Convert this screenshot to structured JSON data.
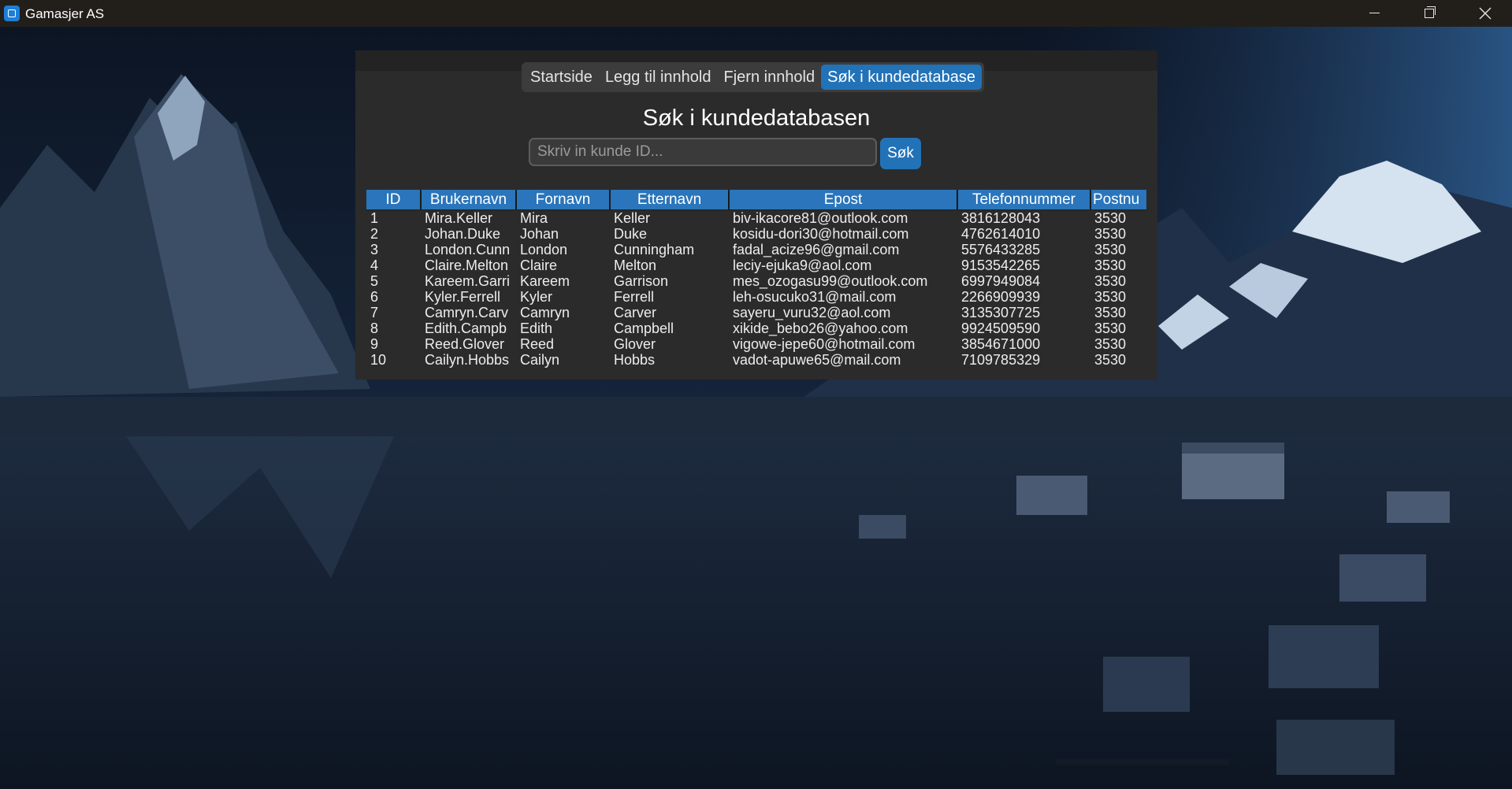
{
  "window": {
    "title": "Gamasjer AS"
  },
  "icons": {
    "app": "app-icon",
    "minimize": "minimize-icon",
    "maximize": "maximize-icon",
    "close": "close-icon"
  },
  "colors": {
    "accent": "#2272b8",
    "panel_bg": "#2b2b2b",
    "titlebar_bg": "#221f1b"
  },
  "nav": {
    "tabs": [
      {
        "label": "Startside",
        "active": false
      },
      {
        "label": "Legg til innhold",
        "active": false
      },
      {
        "label": "Fjern innhold",
        "active": false
      },
      {
        "label": "Søk i kundedatabase",
        "active": true
      }
    ]
  },
  "page": {
    "title": "Søk i kundedatabasen"
  },
  "search": {
    "placeholder": "Skriv in kunde ID...",
    "value": "",
    "button_label": "Søk"
  },
  "table": {
    "columns": [
      "ID",
      "Brukernavn",
      "Fornavn",
      "Etternavn",
      "Epost",
      "Telefonnummer",
      "Postnu"
    ],
    "rows": [
      [
        "1",
        "Mira.Keller",
        "Mira",
        "Keller",
        "biv-ikacore81@outlook.com",
        "3816128043",
        "3530"
      ],
      [
        "2",
        "Johan.Duke",
        "Johan",
        "Duke",
        "kosidu-dori30@hotmail.com",
        "4762614010",
        "3530"
      ],
      [
        "3",
        "London.Cunn",
        "London",
        "Cunningham",
        "fadal_acize96@gmail.com",
        "5576433285",
        "3530"
      ],
      [
        "4",
        "Claire.Melton",
        "Claire",
        "Melton",
        "leciy-ejuka9@aol.com",
        "9153542265",
        "3530"
      ],
      [
        "5",
        "Kareem.Garri",
        "Kareem",
        "Garrison",
        "mes_ozogasu99@outlook.com",
        "6997949084",
        "3530"
      ],
      [
        "6",
        "Kyler.Ferrell",
        "Kyler",
        "Ferrell",
        "leh-osucuko31@mail.com",
        "2266909939",
        "3530"
      ],
      [
        "7",
        "Camryn.Carv",
        "Camryn",
        "Carver",
        "sayeru_vuru32@aol.com",
        "3135307725",
        "3530"
      ],
      [
        "8",
        "Edith.Campb",
        "Edith",
        "Campbell",
        "xikide_bebo26@yahoo.com",
        "9924509590",
        "3530"
      ],
      [
        "9",
        "Reed.Glover",
        "Reed",
        "Glover",
        "vigowe-jepe60@hotmail.com",
        "3854671000",
        "3530"
      ],
      [
        "10",
        "Cailyn.Hobbs",
        "Cailyn",
        "Hobbs",
        "vadot-apuwe65@mail.com",
        "7109785329",
        "3530"
      ]
    ]
  }
}
